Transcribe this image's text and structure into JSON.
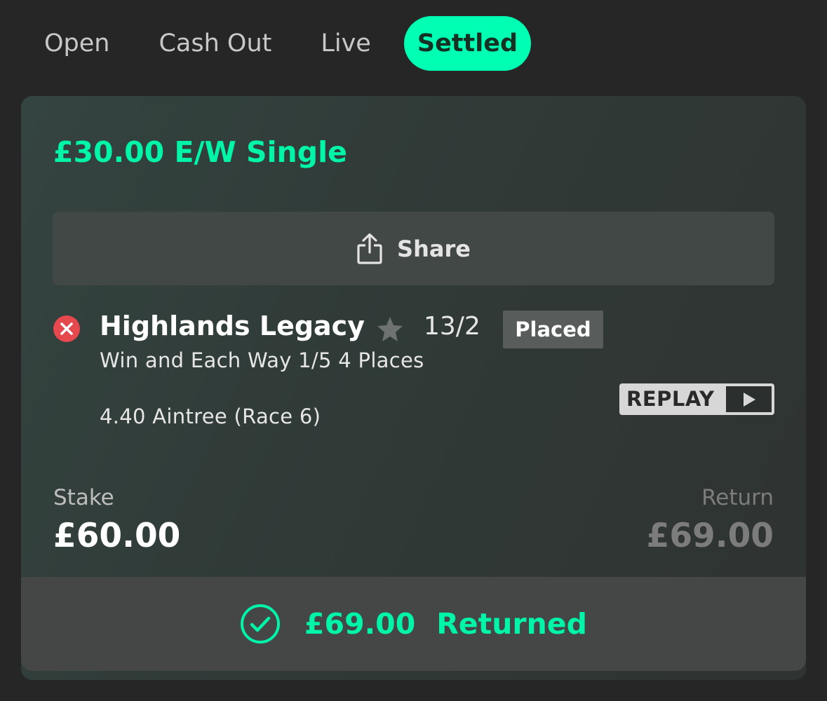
{
  "tabs": [
    {
      "label": "Open",
      "active": false
    },
    {
      "label": "Cash Out",
      "active": false
    },
    {
      "label": "Live",
      "active": false
    },
    {
      "label": "Settled",
      "active": true
    }
  ],
  "bet": {
    "title": "£30.00 E/W Single",
    "share_label": "Share",
    "selection": {
      "name": "Highlands Legacy",
      "odds": "13/2",
      "result_badge": "Placed",
      "market": "Win and Each Way 1/5 4 Places",
      "event": "4.40 Aintree (Race 6)",
      "replay_label": "REPLAY",
      "status_icon": "x-circle-icon",
      "favourite_icon": "star-icon"
    },
    "stake_label": "Stake",
    "stake_value": "£60.00",
    "return_label": "Return",
    "return_value": "£69.00",
    "returned_amount": "£69.00",
    "returned_text": "Returned"
  },
  "colors": {
    "accent": "#00ffb3",
    "accent_text": "#00f5a8",
    "background": "#262626",
    "lost_red": "#e5484d"
  }
}
